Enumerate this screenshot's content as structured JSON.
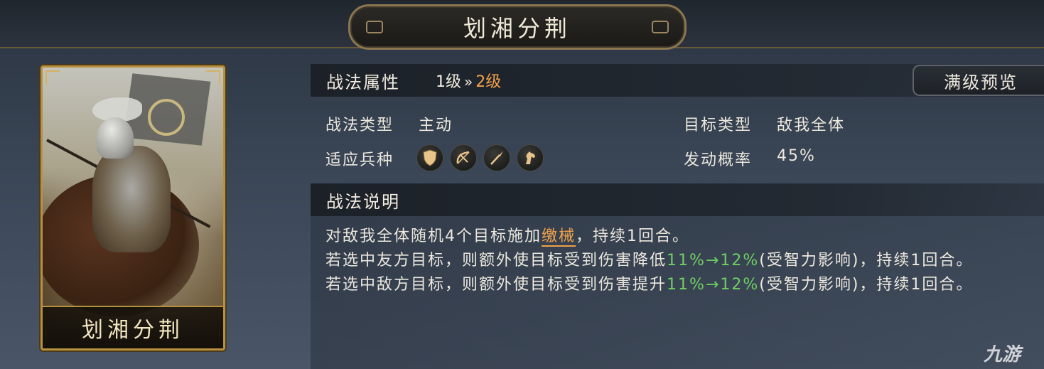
{
  "title": "划湘分荆",
  "card": {
    "name": "划湘分荆"
  },
  "attributes": {
    "header": "战法属性",
    "level_from": "1级",
    "level_arrow": "»",
    "level_to": "2级",
    "preview_button": "满级预览",
    "tactic_type_label": "战法类型",
    "tactic_type_value": "主动",
    "target_type_label": "目标类型",
    "target_type_value": "敌我全体",
    "troop_label": "适应兵种",
    "troop_icons": [
      "shield-icon",
      "bow-icon",
      "spear-icon",
      "horse-icon"
    ],
    "trigger_label": "发动概率",
    "trigger_value": "45%"
  },
  "description": {
    "header": "战法说明",
    "line1_a": "对敌我全体随机4个目标施加",
    "line1_keyword": "缴械",
    "line1_b": "，持续1回合。",
    "line2_a": "若选中友方目标，则额外使目标受到伤害降低",
    "line2_value": "11%→12%",
    "line2_b": "(受智力影响)，持续1回合。",
    "line3_a": "若选中敌方目标，则额外使目标受到伤害提升",
    "line3_value": "11%→12%",
    "line3_b": "(受智力影响)，持续1回合。"
  },
  "watermark": "九游",
  "colors": {
    "accent_orange": "#f0a14a",
    "value_green": "#6fcf63",
    "gold_frame": "#b8913e"
  }
}
